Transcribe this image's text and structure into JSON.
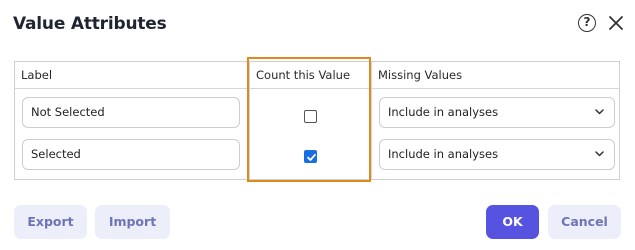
{
  "dialog": {
    "title": "Value Attributes",
    "help_glyph": "?"
  },
  "table": {
    "headers": {
      "label": "Label",
      "count": "Count this Value",
      "missing": "Missing Values"
    },
    "rows": [
      {
        "label": "Not Selected",
        "count_checked": false,
        "missing": "Include in analyses"
      },
      {
        "label": "Selected",
        "count_checked": true,
        "missing": "Include in analyses"
      }
    ]
  },
  "buttons": {
    "export": "Export",
    "import": "Import",
    "ok": "OK",
    "cancel": "Cancel"
  },
  "colors": {
    "accent": "#5653e0",
    "highlight": "#e08a1e",
    "checkbox_checked": "#1a6fe0"
  },
  "icons": {
    "help": "help-circle-icon",
    "close": "close-icon",
    "dropdown": "chevron-down-icon",
    "check": "checkmark-icon"
  }
}
